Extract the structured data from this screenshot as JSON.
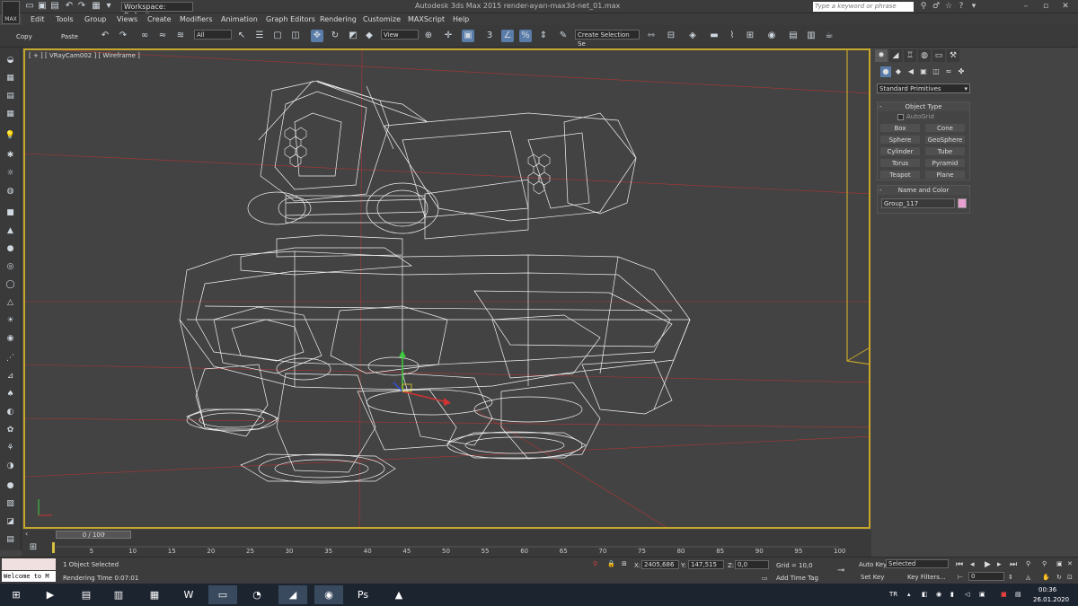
{
  "titlebar": {
    "app_icon_label": "MAX",
    "workspace": "Workspace: Default",
    "title": "Autodesk 3ds Max 2015   render-ayarı-max3d-net_01.max",
    "search_placeholder": "Type a keyword or phrase"
  },
  "menu": [
    "Edit",
    "Tools",
    "Group",
    "Views",
    "Create",
    "Modifiers",
    "Animation",
    "Graph Editors",
    "Rendering",
    "Customize",
    "MAXScript",
    "Help"
  ],
  "toolbar": {
    "copy_label": "Copy",
    "paste_label": "Paste",
    "filter_value": "All",
    "refcoord_value": "View",
    "snap_label": "3",
    "selection_set_value": "Create Selection Se"
  },
  "viewport": {
    "label": "[ + ] [ VRayCam002 ] [ Wireframe ]",
    "accent_color": "#c7a72a"
  },
  "command_panel": {
    "category_dropdown": "Standard Primitives",
    "object_type_title": "Object Type",
    "autogrid_label": "AutoGrid",
    "buttons": [
      "Box",
      "Cone",
      "Sphere",
      "GeoSphere",
      "Cylinder",
      "Tube",
      "Torus",
      "Pyramid",
      "Teapot",
      "Plane"
    ],
    "name_color_title": "Name and Color",
    "object_name": "Group_117",
    "object_color": "#e8a0d0"
  },
  "timeline": {
    "slider_label": "0 / 100",
    "ticks": [
      "5",
      "10",
      "15",
      "20",
      "25",
      "30",
      "35",
      "40",
      "45",
      "50",
      "55",
      "60",
      "65",
      "70",
      "75",
      "80",
      "85",
      "90",
      "95",
      "100"
    ]
  },
  "status": {
    "welcome": "Welcome to M",
    "selection": "1 Object Selected",
    "render_time": "Rendering Time  0:07:01",
    "x_label": "X:",
    "x_value": "2405,686",
    "y_label": "Y:",
    "y_value": "147,515",
    "z_label": "Z:",
    "z_value": "0,0",
    "grid": "Grid = 10,0",
    "add_time_tag": "Add Time Tag",
    "auto_key": "Auto Key",
    "auto_key_value": "Selected",
    "set_key": "Set Key",
    "key_filters": "Key Filters...",
    "frame_value": "0"
  },
  "taskbar": {
    "lang": "TR",
    "time": "00:36",
    "date": "26.01.2020",
    "apps": [
      "start",
      "media",
      "winrar",
      "trello",
      "calculator",
      "word",
      "explorer",
      "whatsapp",
      "3dsmax",
      "chrome",
      "photoshop",
      "autocad"
    ]
  }
}
